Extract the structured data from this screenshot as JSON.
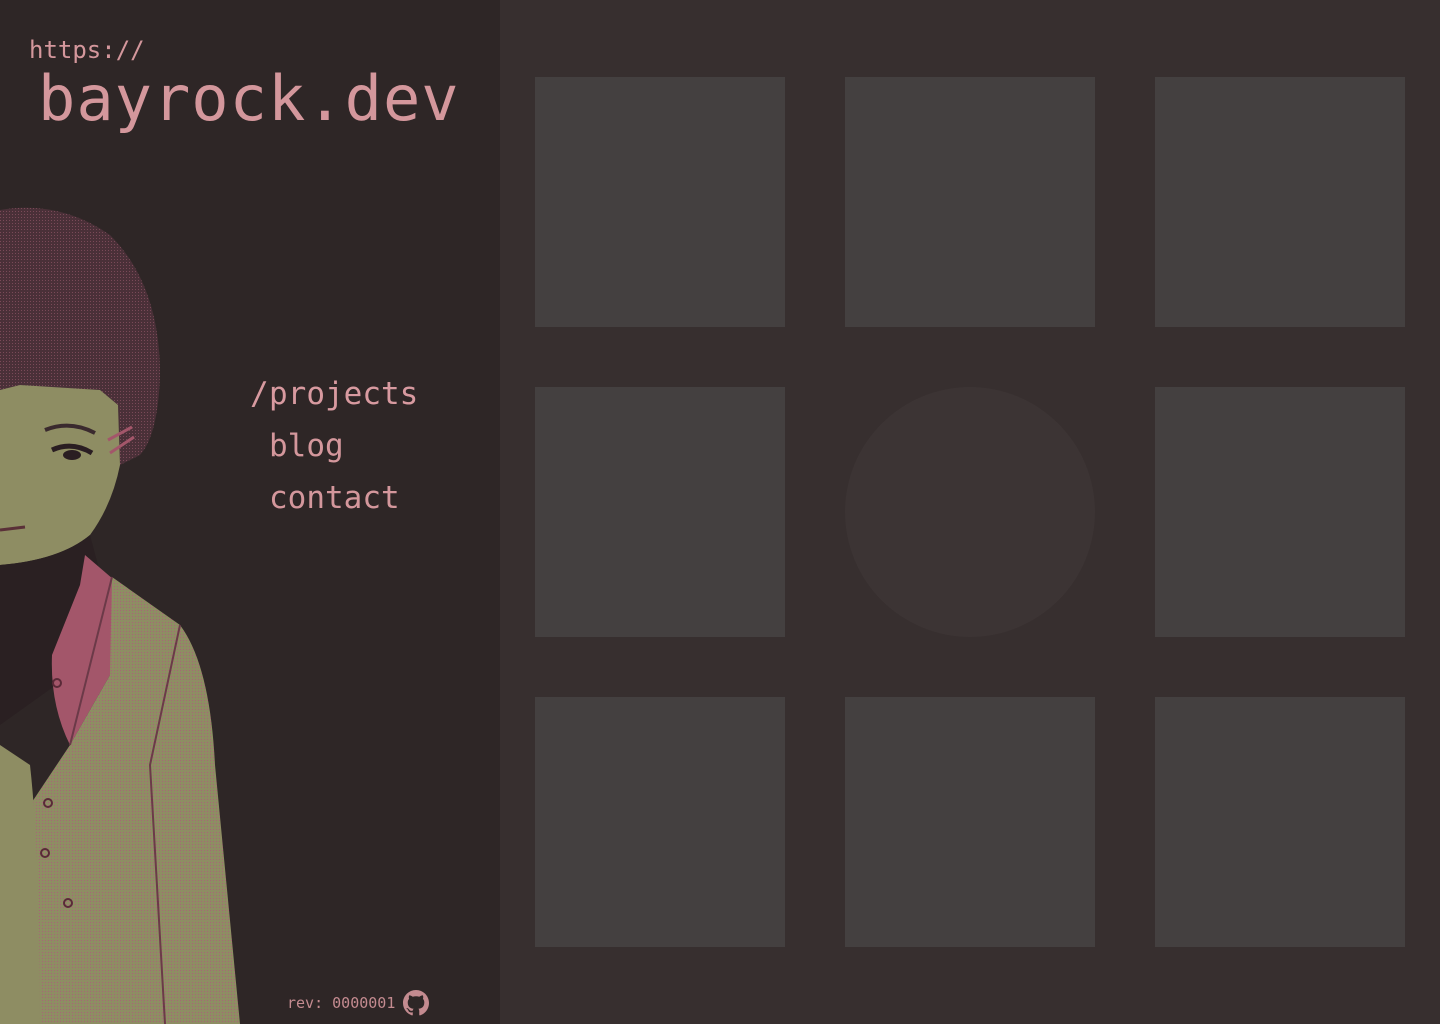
{
  "header": {
    "protocol": "https://",
    "title": "bayrock.dev"
  },
  "nav": {
    "items": [
      {
        "slash": "/",
        "label": "projects",
        "active": true
      },
      {
        "slash": "",
        "label": "blog",
        "active": false
      },
      {
        "slash": "",
        "label": "contact",
        "active": false
      }
    ]
  },
  "footer": {
    "rev_label": "rev: 0000001",
    "icon": "github-icon"
  },
  "portrait": {
    "icon": "anime-character-portrait"
  },
  "grid": {
    "tiles": [
      {
        "shape": "square"
      },
      {
        "shape": "square"
      },
      {
        "shape": "square"
      },
      {
        "shape": "square"
      },
      {
        "shape": "circle"
      },
      {
        "shape": "square"
      },
      {
        "shape": "square"
      },
      {
        "shape": "square"
      },
      {
        "shape": "square"
      }
    ]
  },
  "colors": {
    "sidebar_bg": "#2e2626",
    "main_bg": "#372f2f",
    "accent": "#d4979c",
    "tile": "#444040",
    "skin": "#8e8d63",
    "shirt": "#a3566a"
  }
}
